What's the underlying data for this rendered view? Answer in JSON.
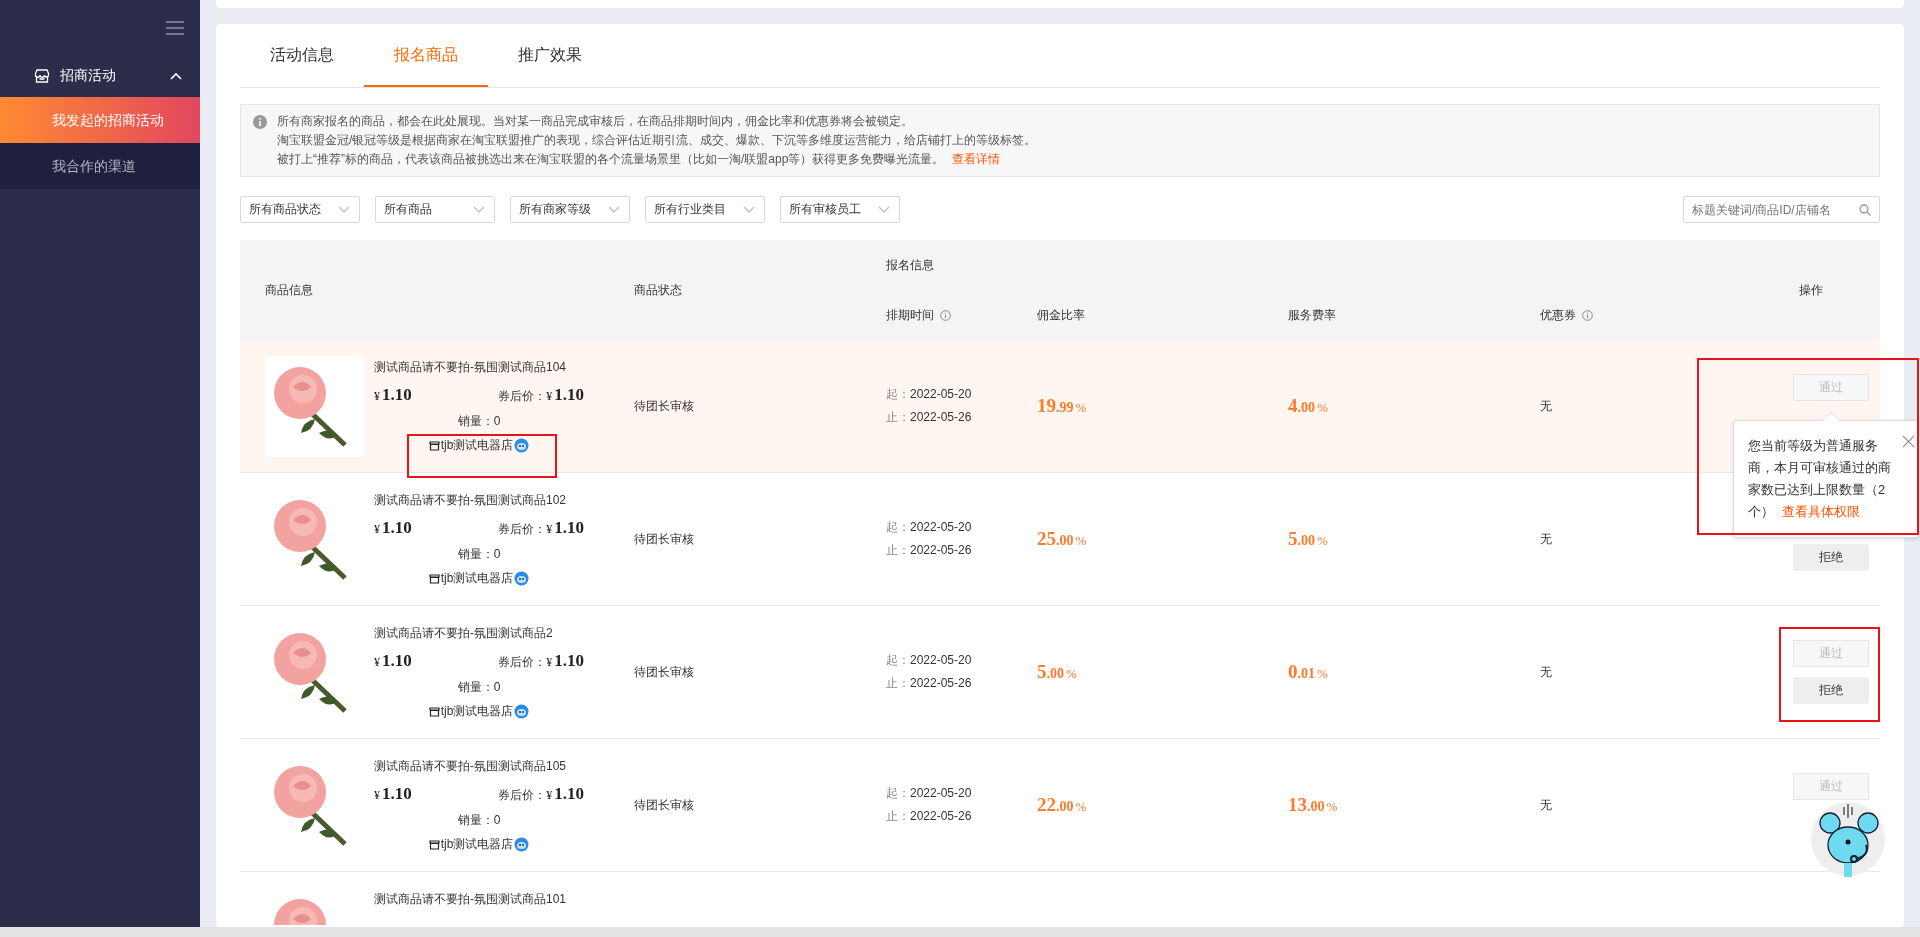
{
  "sidebar": {
    "group": {
      "label": "招商活动",
      "expanded": true
    },
    "items": [
      {
        "label": "我发起的招商活动",
        "selected": true
      },
      {
        "label": "我合作的渠道",
        "selected": false
      }
    ]
  },
  "tabs": [
    {
      "label": "活动信息",
      "selected": false
    },
    {
      "label": "报名商品",
      "selected": true
    },
    {
      "label": "推广效果",
      "selected": false
    }
  ],
  "notice": {
    "lines": [
      "所有商家报名的商品，都会在此处展现。当对某一商品完成审核后，在商品排期时间内，佣金比率和优惠券将会被锁定。",
      "淘宝联盟金冠/银冠等级是根据商家在淘宝联盟推广的表现，综合评估近期引流、成交、爆款、下沉等多维度运营能力，给店铺打上的等级标签。",
      "被打上“推荐”标的商品，代表该商品被挑选出来在淘宝联盟的各个流量场景里（比如一淘/联盟app等）获得更多免费曝光流量。"
    ],
    "link": "查看详情"
  },
  "filters": [
    "所有商品状态",
    "所有商品",
    "所有商家等级",
    "所有行业类目",
    "所有审核员工"
  ],
  "search": {
    "placeholder": "标题关键词/商品ID/店铺名"
  },
  "table": {
    "columns": {
      "product": "商品信息",
      "status": "商品状态",
      "signup": "报名信息",
      "schedule": "排期时间",
      "commission": "佣金比率",
      "service_fee": "服务费率",
      "coupon": "优惠券",
      "actions": "操作"
    },
    "rows": [
      {
        "kind": "full",
        "highlighted": true,
        "title": "测试商品请不要拍-氛围测试商品104",
        "currency": "¥",
        "price": "1.10",
        "coupon_price_label": "券后价：",
        "coupon_price": "1.10",
        "sales_label": "销量：",
        "sales": "0",
        "shop": "tjb测试电器店",
        "status": "待团长审核",
        "start_label": "起：",
        "start": "2022-05-20",
        "end_label": "止：",
        "end": "2022-05-26",
        "commission": {
          "whole": "19",
          "fraction": ".99",
          "unit": "%"
        },
        "service_fee": {
          "whole": "4",
          "fraction": ".00",
          "unit": "%"
        },
        "coupon": "无",
        "actions": [
          {
            "kind": "approve",
            "label": "通过",
            "disabled": true
          }
        ]
      },
      {
        "kind": "full",
        "highlighted": false,
        "title": "测试商品请不要拍-氛围测试商品102",
        "currency": "¥",
        "price": "1.10",
        "coupon_price_label": "券后价：",
        "coupon_price": "1.10",
        "sales_label": "销量：",
        "sales": "0",
        "shop": "tjb测试电器店",
        "status": "待团长审核",
        "start_label": "起：",
        "start": "2022-05-20",
        "end_label": "止：",
        "end": "2022-05-26",
        "commission": {
          "whole": "25",
          "fraction": ".00",
          "unit": "%"
        },
        "service_fee": {
          "whole": "5",
          "fraction": ".00",
          "unit": "%"
        },
        "coupon": "无",
        "actions": [
          {
            "kind": "reject",
            "label": "拒绝",
            "disabled": false
          }
        ]
      },
      {
        "kind": "full",
        "highlighted": false,
        "title": "测试商品请不要拍-氛围测试商品2",
        "currency": "¥",
        "price": "1.10",
        "coupon_price_label": "券后价：",
        "coupon_price": "1.10",
        "sales_label": "销量：",
        "sales": "0",
        "shop": "tjb测试电器店",
        "status": "待团长审核",
        "start_label": "起：",
        "start": "2022-05-20",
        "end_label": "止：",
        "end": "2022-05-26",
        "commission": {
          "whole": "5",
          "fraction": ".00",
          "unit": "%"
        },
        "service_fee": {
          "whole": "0",
          "fraction": ".01",
          "unit": "%"
        },
        "coupon": "无",
        "actions": [
          {
            "kind": "approve",
            "label": "通过",
            "disabled": true
          },
          {
            "kind": "reject",
            "label": "拒绝",
            "disabled": false
          }
        ]
      },
      {
        "kind": "full",
        "highlighted": false,
        "title": "测试商品请不要拍-氛围测试商品105",
        "currency": "¥",
        "price": "1.10",
        "coupon_price_label": "券后价：",
        "coupon_price": "1.10",
        "sales_label": "销量：",
        "sales": "0",
        "shop": "tjb测试电器店",
        "status": "待团长审核",
        "start_label": "起：",
        "start": "2022-05-20",
        "end_label": "止：",
        "end": "2022-05-26",
        "commission": {
          "whole": "22",
          "fraction": ".00",
          "unit": "%"
        },
        "service_fee": {
          "whole": "13",
          "fraction": ".00",
          "unit": "%"
        },
        "coupon": "无",
        "actions": [
          {
            "kind": "approve",
            "label": "通过",
            "disabled": true
          }
        ]
      },
      {
        "kind": "partial",
        "highlighted": false,
        "title": "测试商品请不要拍-氛围测试商品101"
      }
    ]
  },
  "tooltip": {
    "text": "您当前等级为普通服务商，本月可审核通过的商家数已达到上限数量（2个）",
    "link": "查看具体权限"
  }
}
